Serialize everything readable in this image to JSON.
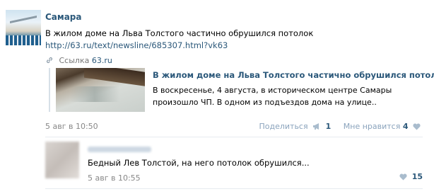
{
  "post": {
    "author": "Самара",
    "text": "В жилом доме на Льва Толстого частично обрушился потолок",
    "link": "http://63.ru/text/newsline/685307.html?vk63",
    "source_prefix": "Ссылка",
    "source_site": "63.ru",
    "attachment": {
      "title": "В жилом доме на Льва Толстого частично обрушился потолок..",
      "description": "В воскресенье, 4 августа, в историческом центре Самары произошло ЧП. В одном из подъездов дома на улице.."
    },
    "date": "5 авг в 10:50",
    "share_label": "Поделиться",
    "share_count": "1",
    "like_label": "Мне нравится",
    "like_count": "4"
  },
  "comment": {
    "text": "Бедный Лев Толстой, на него потолок обрушился...",
    "date": "5 авг в 10:55",
    "like_count": "15"
  },
  "colors": {
    "link": "#2b587a",
    "muted": "#888888",
    "action": "#8aa3bc"
  },
  "icons": {
    "link": "link-icon",
    "share": "megaphone-icon",
    "like": "heart-icon"
  }
}
